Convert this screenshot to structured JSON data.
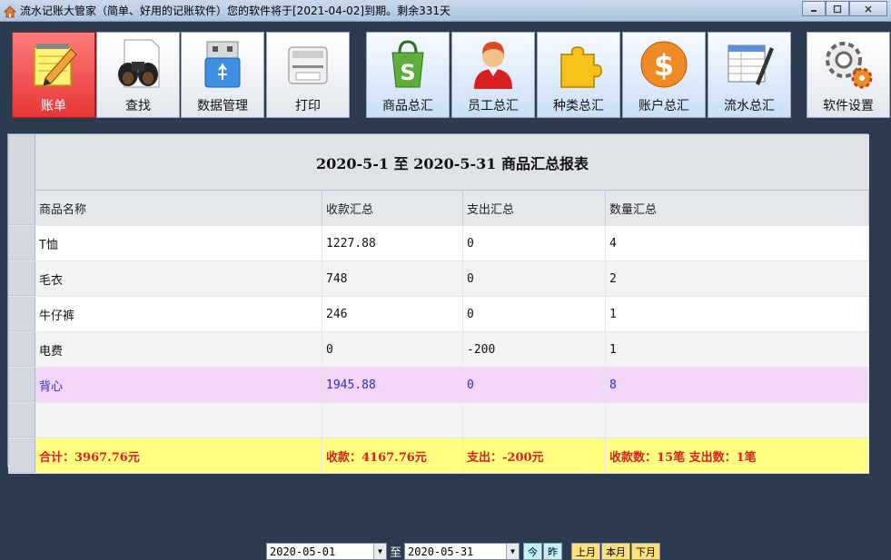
{
  "window": {
    "title": "流水记账大管家（简单、好用的记账软件）您的软件将于[2021-04-02]到期。剩余331天",
    "icon": "house-icon"
  },
  "toolbar": {
    "buttons": [
      {
        "label": "账单",
        "icon": "notepad-pencil-icon"
      },
      {
        "label": "查找",
        "icon": "binoculars-icon"
      },
      {
        "label": "数据管理",
        "icon": "usb-drive-icon"
      },
      {
        "label": "打印",
        "icon": "printer-icon"
      },
      {
        "label": "商品总汇",
        "icon": "shopping-bag-icon"
      },
      {
        "label": "员工总汇",
        "icon": "user-icon"
      },
      {
        "label": "种类总汇",
        "icon": "puzzle-icon"
      },
      {
        "label": "账户总汇",
        "icon": "dollar-coin-icon"
      },
      {
        "label": "流水总汇",
        "icon": "spreadsheet-pen-icon"
      },
      {
        "label": "软件设置",
        "icon": "gear-icon"
      }
    ],
    "active_color": "#e83535"
  },
  "report": {
    "title": "2020-5-1  至  2020-5-31  商品汇总报表",
    "columns": [
      "商品名称",
      "收款汇总",
      "支出汇总",
      "数量汇总"
    ],
    "rows": [
      [
        "T恤",
        "1227.88",
        "0",
        "4"
      ],
      [
        "毛衣",
        "748",
        "0",
        "2"
      ],
      [
        "牛仔裤",
        "246",
        "0",
        "1"
      ],
      [
        "电费",
        "0",
        "-200",
        "1"
      ],
      [
        "背心",
        "1945.88",
        "0",
        "8"
      ],
      [
        "",
        "",
        "",
        ""
      ]
    ],
    "summary": [
      "合计：3967.76元",
      "收款：4167.76元",
      "支出：-200元",
      "收款数：15笔   支出数：1笔"
    ]
  },
  "datebar": {
    "from": "2020-05-01",
    "to_label": "至",
    "to": "2020-05-31",
    "today": "今",
    "yesterday": "昨",
    "last_month": "上月",
    "this_month": "本月",
    "next_month": "下月"
  }
}
